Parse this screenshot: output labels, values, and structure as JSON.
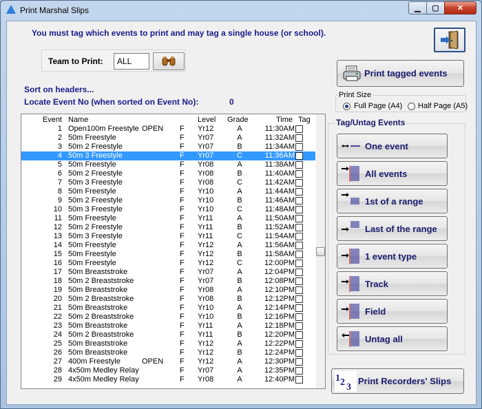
{
  "window": {
    "title": "Print Marshal Slips"
  },
  "instruction": "You must tag which events to print and may tag a single house (or school).",
  "team": {
    "label": "Team to Print:",
    "value": "ALL"
  },
  "sort_hint": "Sort on headers...",
  "locate": {
    "label": "Locate Event No (when sorted on Event No):",
    "value": "0"
  },
  "list": {
    "headers": {
      "event": "Event",
      "name": "Name",
      "level": "Level",
      "grade": "Grade",
      "time": "Time",
      "tag": "Tag"
    },
    "selected_index": 3,
    "rows": [
      {
        "event": "1",
        "name": "Open100m Freestyle",
        "extra": "OPEN",
        "sex": "F",
        "level": "Yr12",
        "grade": "A",
        "time": "11:30AM"
      },
      {
        "event": "2",
        "name": "50m Freestyle",
        "extra": "",
        "sex": "F",
        "level": "Yr07",
        "grade": "A",
        "time": "11:32AM"
      },
      {
        "event": "3",
        "name": "50m 2 Freestyle",
        "extra": "",
        "sex": "F",
        "level": "Yr07",
        "grade": "B",
        "time": "11:34AM"
      },
      {
        "event": "4",
        "name": "50m 3 Freestyle",
        "extra": "",
        "sex": "F",
        "level": "Yr07",
        "grade": "C",
        "time": "11:36AM"
      },
      {
        "event": "5",
        "name": "50m Freestyle",
        "extra": "",
        "sex": "F",
        "level": "Yr08",
        "grade": "A",
        "time": "11:38AM"
      },
      {
        "event": "6",
        "name": "50m 2 Freestyle",
        "extra": "",
        "sex": "F",
        "level": "Yr08",
        "grade": "B",
        "time": "11:40AM"
      },
      {
        "event": "7",
        "name": "50m 3 Freestyle",
        "extra": "",
        "sex": "F",
        "level": "Yr08",
        "grade": "C",
        "time": "11:42AM"
      },
      {
        "event": "8",
        "name": "50m Freestyle",
        "extra": "",
        "sex": "F",
        "level": "Yr10",
        "grade": "A",
        "time": "11:44AM"
      },
      {
        "event": "9",
        "name": "50m 2 Freestyle",
        "extra": "",
        "sex": "F",
        "level": "Yr10",
        "grade": "B",
        "time": "11:46AM"
      },
      {
        "event": "10",
        "name": "50m 3 Freestyle",
        "extra": "",
        "sex": "F",
        "level": "Yr10",
        "grade": "C",
        "time": "11:48AM"
      },
      {
        "event": "11",
        "name": "50m Freestyle",
        "extra": "",
        "sex": "F",
        "level": "Yr11",
        "grade": "A",
        "time": "11:50AM"
      },
      {
        "event": "12",
        "name": "50m 2 Freestyle",
        "extra": "",
        "sex": "F",
        "level": "Yr11",
        "grade": "B",
        "time": "11:52AM"
      },
      {
        "event": "13",
        "name": "50m 3 Freestyle",
        "extra": "",
        "sex": "F",
        "level": "Yr11",
        "grade": "C",
        "time": "11:54AM"
      },
      {
        "event": "14",
        "name": "50m Freestyle",
        "extra": "",
        "sex": "F",
        "level": "Yr12",
        "grade": "A",
        "time": "11:56AM"
      },
      {
        "event": "15",
        "name": "50m Freestyle",
        "extra": "",
        "sex": "F",
        "level": "Yr12",
        "grade": "B",
        "time": "11:58AM"
      },
      {
        "event": "16",
        "name": "50m Freestyle",
        "extra": "",
        "sex": "F",
        "level": "Yr12",
        "grade": "C",
        "time": "12:00PM"
      },
      {
        "event": "17",
        "name": "50m Breaststroke",
        "extra": "",
        "sex": "F",
        "level": "Yr07",
        "grade": "A",
        "time": "12:04PM"
      },
      {
        "event": "18",
        "name": "50m 2 Breaststroke",
        "extra": "",
        "sex": "F",
        "level": "Yr07",
        "grade": "B",
        "time": "12:08PM"
      },
      {
        "event": "19",
        "name": "50m Breaststroke",
        "extra": "",
        "sex": "F",
        "level": "Yr08",
        "grade": "A",
        "time": "12:10PM"
      },
      {
        "event": "20",
        "name": "50m 2 Breaststroke",
        "extra": "",
        "sex": "F",
        "level": "Yr08",
        "grade": "B",
        "time": "12:12PM"
      },
      {
        "event": "21",
        "name": "50m Breaststroke",
        "extra": "",
        "sex": "F",
        "level": "Yr10",
        "grade": "A",
        "time": "12:14PM"
      },
      {
        "event": "22",
        "name": "50m 2 Breaststroke",
        "extra": "",
        "sex": "F",
        "level": "Yr10",
        "grade": "B",
        "time": "12:16PM"
      },
      {
        "event": "23",
        "name": "50m Breaststroke",
        "extra": "",
        "sex": "F",
        "level": "Yr11",
        "grade": "A",
        "time": "12:18PM"
      },
      {
        "event": "24",
        "name": "50m 2 Breaststroke",
        "extra": "",
        "sex": "F",
        "level": "Yr11",
        "grade": "B",
        "time": "12:20PM"
      },
      {
        "event": "25",
        "name": "50m Breaststroke",
        "extra": "",
        "sex": "F",
        "level": "Yr12",
        "grade": "A",
        "time": "12:22PM"
      },
      {
        "event": "26",
        "name": "50m Breaststroke",
        "extra": "",
        "sex": "F",
        "level": "Yr12",
        "grade": "B",
        "time": "12:24PM"
      },
      {
        "event": "27",
        "name": "400m Freestyle",
        "extra": "OPEN",
        "sex": "F",
        "level": "Yr12",
        "grade": "A",
        "time": "12:30PM"
      },
      {
        "event": "28",
        "name": "4x50m Medley Relay",
        "extra": "",
        "sex": "F",
        "level": "Yr07",
        "grade": "A",
        "time": "12:35PM"
      },
      {
        "event": "29",
        "name": "4x50m Medley Relay",
        "extra": "",
        "sex": "F",
        "level": "Yr08",
        "grade": "A",
        "time": "12:40PM"
      }
    ]
  },
  "print_button": {
    "label": "Print tagged events",
    "icon": "printer-icon"
  },
  "print_size": {
    "label": "Print Size",
    "options": [
      {
        "label": "Full Page (A4)",
        "selected": true
      },
      {
        "label": "Half Page (A5)",
        "selected": false
      }
    ]
  },
  "tag_group": {
    "title": "Tag/Untag Events",
    "buttons": [
      {
        "label": "One event",
        "name": "one-event-button",
        "icon": "one-event-icon"
      },
      {
        "label": "All events",
        "name": "all-events-button",
        "icon": "all-events-icon"
      },
      {
        "label": "1st of a range",
        "name": "first-of-range-button",
        "icon": "range-start-icon"
      },
      {
        "label": "Last of the range",
        "name": "last-of-range-button",
        "icon": "range-end-icon"
      },
      {
        "label": "1 event type",
        "name": "event-type-button",
        "icon": "event-type-icon"
      },
      {
        "label": "Track",
        "name": "track-button",
        "icon": "track-icon"
      },
      {
        "label": "Field",
        "name": "field-button",
        "icon": "field-icon"
      },
      {
        "label": "Untag all",
        "name": "untag-all-button",
        "icon": "untag-all-icon"
      }
    ]
  },
  "recorders_button": {
    "label": "Print Recorders' Slips",
    "icon": "recorders-123-icon"
  },
  "colors": {
    "heading_blue": "#1a1a8a",
    "selection": "#3399ff",
    "button_text": "#1a1a6e"
  }
}
